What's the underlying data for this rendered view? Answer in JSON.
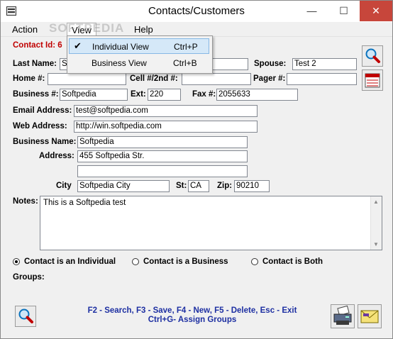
{
  "window": {
    "title": "Contacts/Customers",
    "minimize": "—",
    "maximize": "☐",
    "close": "✕"
  },
  "menu": {
    "action": "Action",
    "view": "View",
    "help": "Help"
  },
  "watermark": "SOFTPEDIA",
  "view_menu": {
    "items": [
      {
        "label": "Individual View",
        "shortcut": "Ctrl+P",
        "checked": true
      },
      {
        "label": "Business View",
        "shortcut": "Ctrl+B",
        "checked": false
      }
    ],
    "check_glyph": "✔"
  },
  "contact": {
    "id_label": "Contact Id: 6",
    "last_name_label": "Last Name:",
    "last_name": "S",
    "spouse_label": "Spouse:",
    "spouse": "Test 2",
    "home_label": "Home #:",
    "home": "",
    "cell_label": "Cell #/2nd #:",
    "cell": "",
    "pager_label": "Pager #:",
    "pager": "",
    "business_label": "Business #:",
    "business": "Softpedia",
    "ext_label": "Ext:",
    "ext": "220",
    "fax_label": "Fax #:",
    "fax": "2055633",
    "email_label": "Email Address:",
    "email": "test@softpedia.com",
    "web_label": "Web Address:",
    "web": "http://win.softpedia.com",
    "business_name_label": "Business Name:",
    "business_name": "Softpedia",
    "address_label": "Address:",
    "address1": "455 Softpedia Str.",
    "address2": "",
    "city_label": "City",
    "city": "Softpedia City",
    "st_label": "St:",
    "st": "CA",
    "zip_label": "Zip:",
    "zip": "90210",
    "notes_label": "Notes:",
    "notes": "This is a Softpedia test"
  },
  "contact_type": {
    "options": [
      "Contact is an Individual",
      "Contact is a Business",
      "Contact is Both"
    ],
    "selected": "Contact is an Individual"
  },
  "groups_label": "Groups:",
  "hints": {
    "line1": "F2 - Search,  F3 - Save,  F4 - New,  F5 - Delete,  Esc - Exit",
    "line2": "Ctrl+G- Assign Groups"
  },
  "colors": {
    "accent_red": "#c00000",
    "hint_blue": "#1d2fa2",
    "close_red": "#c7463b"
  }
}
